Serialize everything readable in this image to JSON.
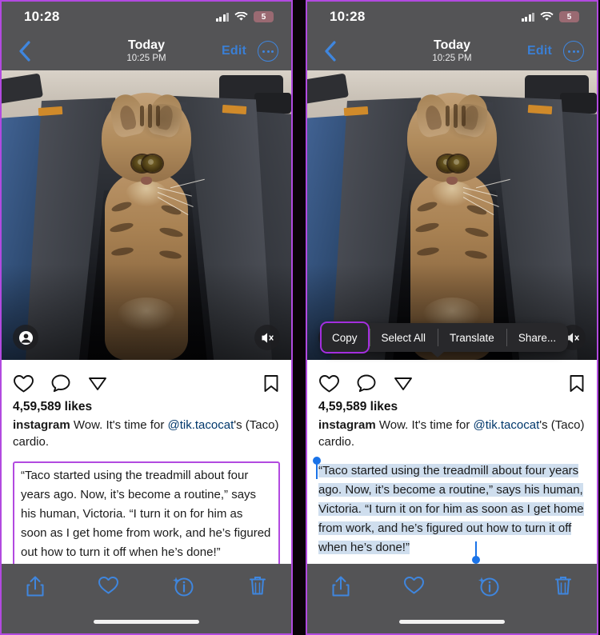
{
  "meta": {
    "accent_purple": "#b24ae0",
    "menu_highlight_purple": "#a42ede",
    "ios_blue": "#3a7fd5",
    "selection_blue": "#cfdeee",
    "chrome_gray": "#545456"
  },
  "status_bar": {
    "time": "10:28",
    "battery_level": "5",
    "cellular_icon": "cellular-bars-icon",
    "wifi_icon": "wifi-icon",
    "battery_icon": "battery-icon"
  },
  "nav_bar": {
    "back_icon": "back-chevron-icon",
    "title": "Today",
    "subtitle": "10:25 PM",
    "edit_label": "Edit",
    "more_icon": "more-circle-icon"
  },
  "media": {
    "description": "Bengal cat walking on a treadmill",
    "person_icon": "person-circle-icon",
    "mute_icon": "speaker-muted-icon"
  },
  "post": {
    "like_icon": "heart-icon",
    "comment_icon": "comment-bubble-icon",
    "share_icon": "paper-plane-icon",
    "save_icon": "bookmark-icon",
    "likes": "4,59,589 likes",
    "username": "instagram",
    "caption_text": " Wow. It's time for ",
    "caption_mention": "@tik.tacocat",
    "caption_tail": "'s (Taco) cardio.",
    "quote": "“Taco started using the treadmill about four years ago. Now, it’s become a routine,” says his human, Victoria. “I turn it on for him as soon as I get home from work, and he’s figured out how to turn it off when he’s done!”",
    "livetext_icon": "live-text-scan-icon"
  },
  "context_menu": {
    "items": [
      {
        "label": "Copy",
        "highlighted": true
      },
      {
        "label": "Select All",
        "highlighted": false
      },
      {
        "label": "Translate",
        "highlighted": false
      },
      {
        "label": "Share...",
        "highlighted": false
      }
    ]
  },
  "toolbar": {
    "share_icon": "share-up-icon",
    "favorite_icon": "heart-outline-icon",
    "info_icon": "info-sparkle-icon",
    "delete_icon": "trash-icon"
  },
  "panels": {
    "left_state": "quote text highlighted with purple callout box",
    "right_state": "text selected with iOS edit menu showing Copy highlighted"
  }
}
